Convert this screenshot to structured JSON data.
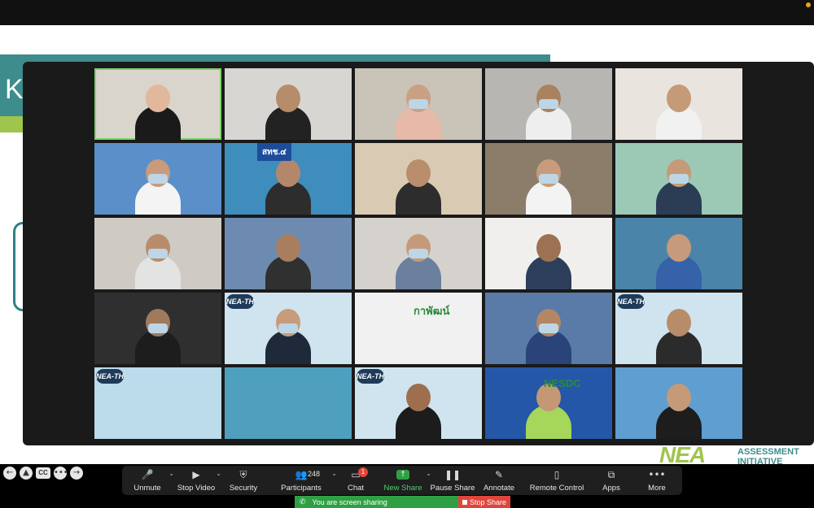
{
  "slide": {
    "title_letter": "K"
  },
  "logo": {
    "mark": "NEA",
    "line1": "ASSESSMENT",
    "line2": "INITIATIVE"
  },
  "tiles": [
    {
      "bg": "#d9d4cc",
      "shirt": "#1a1a1a",
      "head": "#e1b89c",
      "mask": false,
      "active": true
    },
    {
      "bg": "#d8d6d2",
      "shirt": "#222222",
      "head": "#b68c6a",
      "mask": false
    },
    {
      "bg": "#c9c3b8",
      "shirt": "#e7b9a8",
      "head": "#caa083",
      "mask": true
    },
    {
      "bg": "#b8b6b3",
      "shirt": "#eeeeee",
      "head": "#a9825f",
      "mask": true
    },
    {
      "bg": "#e9e4de",
      "shirt": "#f1f1f1",
      "head": "#c49a78",
      "mask": false
    },
    {
      "bg": "#5b8fc9",
      "shirt": "#f4f4f4",
      "head": "#c99a7c",
      "mask": true
    },
    {
      "bg": "#3e8dbd",
      "shirt": "#2d2d2d",
      "head": "#b5876a",
      "mask": false,
      "banner": "สทช.๔",
      "banner_color": "#1d4d9a"
    },
    {
      "bg": "#d9cbb3",
      "shirt": "#2d2d2d",
      "head": "#b98e6c",
      "mask": false
    },
    {
      "bg": "#8c7d6b",
      "shirt": "#f3f3f3",
      "head": "#c89c7a",
      "mask": true
    },
    {
      "bg": "#9bc9b5",
      "shirt": "#2b3d55",
      "head": "#c49a78",
      "mask": true
    },
    {
      "bg": "#cfcac3",
      "shirt": "#e3e3e3",
      "head": "#b98d6b",
      "mask": true
    },
    {
      "bg": "#6d8bb0",
      "shirt": "#303030",
      "head": "#a97e5e",
      "mask": false
    },
    {
      "bg": "#d5d2cd",
      "shirt": "#6b7f9e",
      "head": "#c59a7b",
      "mask": true
    },
    {
      "bg": "#f0efed",
      "shirt": "#2c3e5a",
      "head": "#9d7253",
      "mask": false
    },
    {
      "bg": "#4a84a9",
      "shirt": "#3562a8",
      "head": "#c69b7c",
      "mask": false
    },
    {
      "bg": "#2f2f2f",
      "shirt": "#1d1d1d",
      "head": "#a07a5d",
      "mask": true
    },
    {
      "bg": "#cfe4ef",
      "shirt": "#1e2a3a",
      "head": "#c89b7a",
      "mask": true,
      "nea": "NEA-TH"
    },
    {
      "bg": "#f1f1f1",
      "shirt": "#f1f1f1",
      "head": "#f1f1f1",
      "mask": false,
      "caption": "กาพัฒน์",
      "empty": true
    },
    {
      "bg": "#5a7aa8",
      "shirt": "#2a4378",
      "head": "#b38664",
      "mask": true
    },
    {
      "bg": "#cfe4ef",
      "shirt": "#2b2b2b",
      "head": "#b98c69",
      "mask": false,
      "nea": "NEA-TH"
    },
    {
      "bg": "#bcdbeb",
      "shirt": "#bcdbeb",
      "head": "#bcdbeb",
      "mask": false,
      "nea": "NEA-TH",
      "empty": true
    },
    {
      "bg": "#4f9fbf",
      "shirt": "#6b8f4f",
      "head": "#d9e6cf",
      "mask": false,
      "empty": true
    },
    {
      "bg": "#cfe4ef",
      "shirt": "#1c1c1c",
      "head": "#9e6f4f",
      "mask": false,
      "nea": "NEA-TH"
    },
    {
      "bg": "#2457a8",
      "shirt": "#a6d65a",
      "head": "#c49874",
      "mask": false,
      "caption": "NESDC"
    },
    {
      "bg": "#5e9ed1",
      "shirt": "#1d1d1d",
      "head": "#c49a78",
      "mask": false
    }
  ],
  "left_controls": [
    "←",
    "▲",
    "CC",
    "•••",
    "→"
  ],
  "toolbar": {
    "items": [
      {
        "icon": "🎤",
        "label": "Unmute",
        "caret": "⌄",
        "name": "unmute"
      },
      {
        "icon": "▶",
        "label": "Stop Video",
        "caret": "⌄",
        "name": "stop-video"
      },
      {
        "icon": "⛨",
        "label": "Security",
        "name": "security"
      },
      {
        "icon": "👥",
        "label": "Participants",
        "caret": "⌄",
        "count": "248",
        "name": "participants"
      },
      {
        "icon": "▭",
        "label": "Chat",
        "badge": "1",
        "name": "chat"
      },
      {
        "icon": "↑",
        "label": "New Share",
        "caret": "⌄",
        "green": true,
        "name": "new-share"
      },
      {
        "icon": "❚❚",
        "label": "Pause Share",
        "name": "pause-share"
      },
      {
        "icon": "✎",
        "label": "Annotate",
        "name": "annotate"
      },
      {
        "icon": "▯",
        "label": "Remote Control",
        "name": "remote-control"
      },
      {
        "icon": "⧉",
        "label": "Apps",
        "name": "apps"
      },
      {
        "icon": "•••",
        "label": "More",
        "name": "more"
      }
    ]
  },
  "share_status": {
    "text": "You are screen sharing",
    "stop_label": "Stop Share"
  },
  "colors": {
    "accent_green": "#2ea043",
    "stop_red": "#e0453b",
    "teal": "#3e8c8c",
    "lime": "#9fc54d"
  }
}
